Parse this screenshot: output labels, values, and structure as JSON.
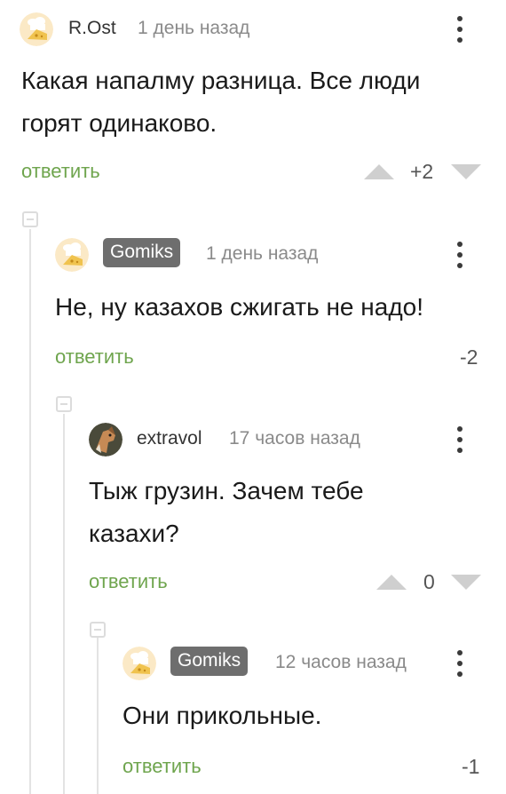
{
  "comments": [
    {
      "user": "R.Ost",
      "time": "1 день назад",
      "text_line1": "Какая напалму разница. Все люди",
      "text_line2": "горят одинаково.",
      "reply": "ответить",
      "rating": "+2"
    },
    {
      "user": "Gomiks",
      "time": "1 день назад",
      "text_line1": "Не, ну казахов сжигать не надо!",
      "reply": "ответить",
      "rating": "-2"
    },
    {
      "user": "extravol",
      "time": "17 часов назад",
      "text_line1": "Тыж грузин. Зачем тебе",
      "text_line2": "казахи?",
      "reply": "ответить",
      "rating": "0"
    },
    {
      "user": "Gomiks",
      "time": "12 часов назад",
      "text_line1": "Они прикольные.",
      "reply": "ответить",
      "rating": "-1"
    }
  ],
  "colors": {
    "reply": "#6fa54e",
    "badge": "#6e6e6e",
    "thread_line": "#e3e3e3"
  },
  "icons": [
    "chef-avatar-icon",
    "dog-avatar-icon",
    "kebab-menu-icon",
    "collapse-icon",
    "upvote-arrow-icon",
    "downvote-arrow-icon"
  ]
}
